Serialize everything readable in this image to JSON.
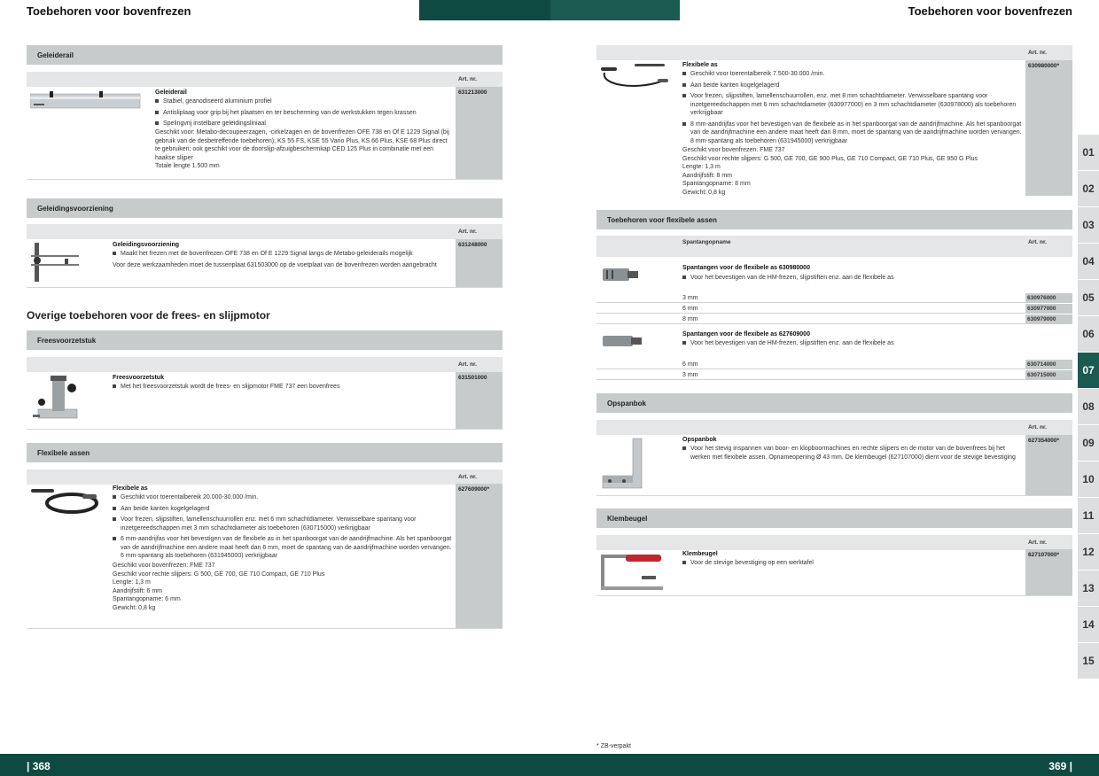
{
  "header": {
    "left_title": "Toebehoren voor bovenfrezen",
    "right_title": "Toebehoren voor bovenfrezen"
  },
  "footer": {
    "left_page": "| 368",
    "right_page": "369 |",
    "footnote": "* ZB-verpakt"
  },
  "artnr_label": "Art. nr.",
  "left": {
    "geleiderail": {
      "section": "Geleiderail",
      "title": "Geleiderail",
      "bullets": [
        "Stabiel, geanodiseerd aluminium profiel",
        "Antisliplaag voor grip bij het plaatsen en ter bescherming van de werkstukken tegen krassen",
        "Spelingvrij instelbare geleidingsliniaal"
      ],
      "text": "Geschikt voor: Metabo-decoupeerzagen, -cirkelzagen en de bovenfrezen OFE 738 en Of E 1229 Signal (bij gebruik van de desbetreffende toebehoren); KS 55 FS, KSE 55 Vario Plus, KS 66 Plus, KSE 68 Plus direct te gebruiken; ook geschikt voor de doorslijp-afzuigbeschermkap CED 125 Plus in combinatie met een haakse slijper",
      "length": "Totale lengte 1.500 mm",
      "artnr": "631213000"
    },
    "geleidingsvoorziening": {
      "section": "Geleidingsvoorziening",
      "title": "Geleidingsvoorziening",
      "bullets": [
        "Maakt het frezen met de bovenfrezen OFE 738 en Of E 1229 Signal langs de Metabo-geleiderails mogelijk"
      ],
      "text": "Voor deze werkzaamheden moet de tussenplaat 631503000 op de voetplaat van de bovenfrezen worden aangebracht",
      "artnr": "631248000"
    },
    "overige_title": "Overige toebehoren voor de frees- en slijpmotor",
    "freesvoorzetstuk": {
      "section": "Freesvoorzetstuk",
      "title": "Freesvoorzetstuk",
      "bullets": [
        "Met het freesvoorzetstuk wordt de frees- en slijpmotor FME 737 een bovenfrees"
      ],
      "artnr": "631501000"
    },
    "flexibele_assen": {
      "section": "Flexibele assen",
      "title": "Flexibele as",
      "bullets": [
        "Geschikt voor toerentalbereik 20.000-30.000 /min.",
        "Aan beide kanten kogelgelagerd",
        "Voor frezen, slijpstiften, lamellenschuurrollen enz. met 6 mm schachtdiameter. Verwisselbare spantang voor inzetgereedschappen met 3 mm schachtdiameter als toebehoren (630715000) verkrijgbaar",
        "6 mm-aandrijfas voor het bevestigen van de flexibele as in het spanboorgat van de aandrijfmachine. Als het spanboorgat van de aandrijfmachine een andere maat heeft dan 6 mm, moet de spantang van de aandrijfmachine worden vervangen. 6 mm-spantang als toebehoren (631945000) verkrijgbaar"
      ],
      "specs": [
        "Geschikt voor bovenfrezen: FME 737",
        "Geschikt voor rechte slijpers: G 500, GE 700, GE 710 Compact, GE 710 Plus",
        "Lengte: 1,3 m",
        "Aandrijfstift: 6 mm",
        "Spantangopname: 6 mm",
        "Gewicht: 0,8 kg"
      ],
      "artnr": "627609000*"
    }
  },
  "right": {
    "flexibele_as": {
      "title": "Flexibele as",
      "bullets": [
        "Geschikt voor toerentalbereik 7.500-30.000 /min.",
        "Aan beide kanten kogelgelagerd",
        "Voor frezen, slijpstiften, lamellenschuurrollen, enz. met 8 mm schachtdiameter. Verwisselbare spantang voor inzetgereedschappen met 6 mm schachtdiameter (630977000) en 3 mm schachtdiameter (630978000) als toebehoren verkrijgbaar",
        "8 mm-aandrijfas voor het bevestigen van de flexibele as in het spanboorgat van de aandrijfmachine. Als het spanboorgat van de aandrijfmachine een andere maat heeft dan 8 mm, moet de spantang van de aandrijfmachine worden vervangen. 8 mm-spantang als toebehoren (631945000) verkrijgbaar"
      ],
      "specs": [
        "Geschikt voor bovenfrezen: FME 737",
        "Geschikt voor rechte slijpers: G 500, GE 700, GE 900 Plus, GE 710 Compact, GE 710 Plus, GE 950 G Plus",
        "Lengte: 1,3 m",
        "Aandrijfstift: 8 mm",
        "Spantangopname: 8 mm",
        "Gewicht: 0,8 kg"
      ],
      "artnr": "630980000*"
    },
    "toebehoren_flex": {
      "section": "Toebehoren voor flexibele assen",
      "subhead": "Spantangopname",
      "group1": {
        "title": "Spantangen voor de flexibele as 630980000",
        "bullet": "Voor het bevestigen van de HM-frezen, slijpstiften enz. aan de flexibele as",
        "rows": [
          {
            "size": "3 mm",
            "artnr": "630976000"
          },
          {
            "size": "6 mm",
            "artnr": "630977000"
          },
          {
            "size": "8 mm",
            "artnr": "630979000"
          }
        ]
      },
      "group2": {
        "title": "Spantangen voor de flexibele as 627609000",
        "bullet": "Voor het bevestigen van de HM-frezen, slijpstiften enz. aan de flexibele as",
        "rows": [
          {
            "size": "6 mm",
            "artnr": "630714000"
          },
          {
            "size": "3 mm",
            "artnr": "630715000"
          }
        ]
      }
    },
    "opspanbok": {
      "section": "Opspanbok",
      "title": "Opspanbok",
      "bullets": [
        "Voor het stevig inspannen van boor- en klopboormachines en rechte slijpers en de motor van de bovenfrees bij het werken met flexibele assen. Opnameopening Ø 43 mm. De klembeugel (627107000) dient voor de stevige bevestiging"
      ],
      "artnr": "627354000*"
    },
    "klembeugel": {
      "section": "Klembeugel",
      "title": "Klembeugel",
      "bullets": [
        "Voor de stevige bevestiging op een werktafel"
      ],
      "artnr": "627107000*"
    }
  },
  "tabs": [
    "01",
    "02",
    "03",
    "04",
    "05",
    "06",
    "07",
    "08",
    "09",
    "10",
    "11",
    "12",
    "13",
    "14",
    "15"
  ],
  "active_tab": "07",
  "colors": {
    "teal_dark": "#0f4a42",
    "teal": "#1a5a50",
    "gray_bar": "#c8cbcc"
  }
}
